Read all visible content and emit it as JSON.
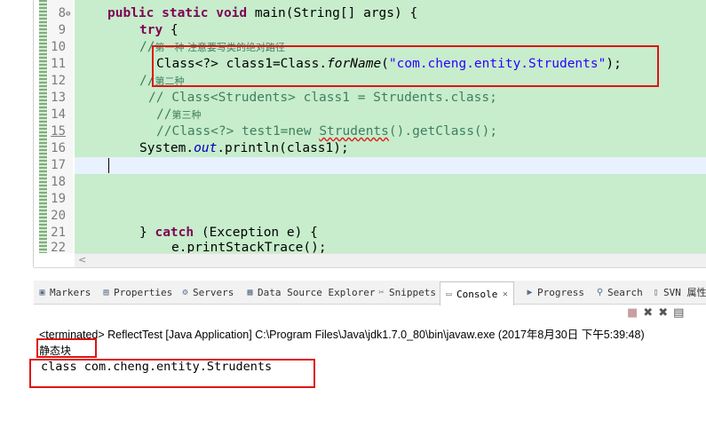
{
  "editor": {
    "lines": [
      {
        "num": "8"
      },
      {
        "num": "9"
      },
      {
        "num": "10"
      },
      {
        "num": "11"
      },
      {
        "num": "12"
      },
      {
        "num": "13"
      },
      {
        "num": "14"
      },
      {
        "num": "15"
      },
      {
        "num": "16"
      },
      {
        "num": "17"
      },
      {
        "num": "18"
      },
      {
        "num": "19"
      },
      {
        "num": "20"
      },
      {
        "num": "21"
      },
      {
        "num": "22"
      }
    ],
    "code": {
      "l8_kw": "public static void",
      "l8_rest": " main(String[] args) {",
      "l9_kw": "try",
      "l9_rest": " {",
      "l10_slashes": "//",
      "l10_comment": "第一种 注意要写类的绝对路径",
      "l11_a": "Class<?> class1=Class.",
      "l11_method": "forName",
      "l11_b": "(",
      "l11_str": "\"com.cheng.entity.Strudents\"",
      "l11_c": ");",
      "l12_slashes": "//",
      "l12_comment": "第二种",
      "l13": "// Class<Strudents> class1 = Strudents.class;",
      "l14_slashes": "//",
      "l14_comment": "第三种",
      "l15_a": "//Class<?> test1=new ",
      "l15_squig": "Strudents",
      "l15_b": "().getClass();",
      "l16_a": "System.",
      "l16_field": "out",
      "l16_b": ".println(class1);",
      "l21_a": "} ",
      "l21_kw": "catch",
      "l21_b": " (Exception e) {",
      "l22": "e.printStackTrace();"
    },
    "scroll_arrow": "<"
  },
  "tabs": [
    {
      "label": "Markers",
      "icon": "markers-icon",
      "glyph": "▣"
    },
    {
      "label": "Properties",
      "icon": "properties-icon",
      "glyph": "▤"
    },
    {
      "label": "Servers",
      "icon": "servers-icon",
      "glyph": "⚙"
    },
    {
      "label": "Data Source Explorer",
      "icon": "data-source-icon",
      "glyph": "▦"
    },
    {
      "label": "Snippets",
      "icon": "snippets-icon",
      "glyph": "✂"
    },
    {
      "label": "Console",
      "icon": "console-icon",
      "glyph": "▭",
      "close": "✕"
    },
    {
      "label": "Progress",
      "icon": "progress-icon",
      "glyph": "▶"
    },
    {
      "label": "Search",
      "icon": "search-icon",
      "glyph": "⚲"
    },
    {
      "label": "SVN 属性",
      "icon": "svn-icon",
      "glyph": "▯"
    }
  ],
  "console": {
    "terminated": "<terminated> ReflectTest [Java Application] C:\\Program Files\\Java\\jdk1.7.0_80\\bin\\javaw.exe (2017年8月30日 下午5:39:48)",
    "output_line1": "静态块",
    "output_line2": "class com.cheng.entity.Strudents"
  },
  "colors": {
    "editor_bg": "#c7edcc",
    "keyword": "#7f0055",
    "comment": "#3f7f5f",
    "string": "#2a00ff",
    "highlight_box": "#e01313"
  }
}
